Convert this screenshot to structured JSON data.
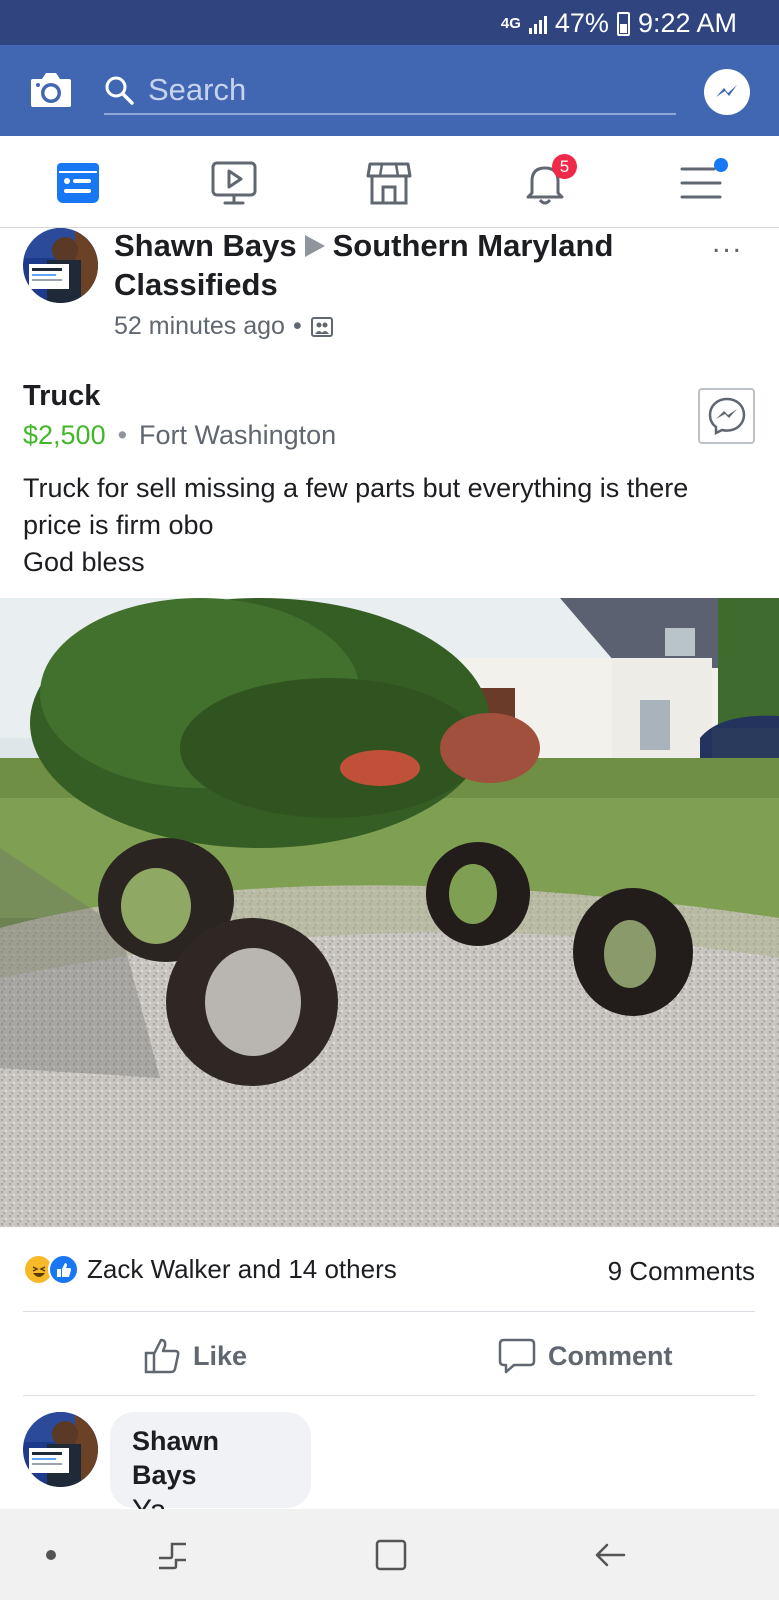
{
  "status_bar": {
    "network": "4G",
    "battery": "47%",
    "time": "9:22 AM"
  },
  "header": {
    "search_placeholder": "Search"
  },
  "nav": {
    "notification_count": "5"
  },
  "post": {
    "author": "Shawn Bays",
    "group": "Southern Maryland Classifieds",
    "time": "52 minutes ago",
    "item_title": "Truck",
    "price": "$2,500",
    "separator": "•",
    "location": "Fort Washington",
    "description_lines": [
      "Truck for sell missing a few parts but everything is there",
      "price is firm obo",
      "God bless"
    ],
    "reactions_text": "Zack Walker and 14 others",
    "comments_count": "9 Comments",
    "like_label": "Like",
    "comment_label": "Comment",
    "more": "..."
  },
  "comment": {
    "author": "Shawn Bays",
    "text": "Ya"
  },
  "colors": {
    "status_bar": "#30457f",
    "header": "#4267b2",
    "price": "#42b72a",
    "badge": "#f02849",
    "accent": "#1877f2"
  },
  "icons": [
    "camera-icon",
    "search-icon",
    "messenger-icon",
    "news-feed-icon",
    "watch-icon",
    "marketplace-icon",
    "bell-icon",
    "menu-icon",
    "photo-icon",
    "haha-icon",
    "like-icon",
    "comment-icon",
    "recents-icon",
    "home-square-icon",
    "back-icon"
  ]
}
